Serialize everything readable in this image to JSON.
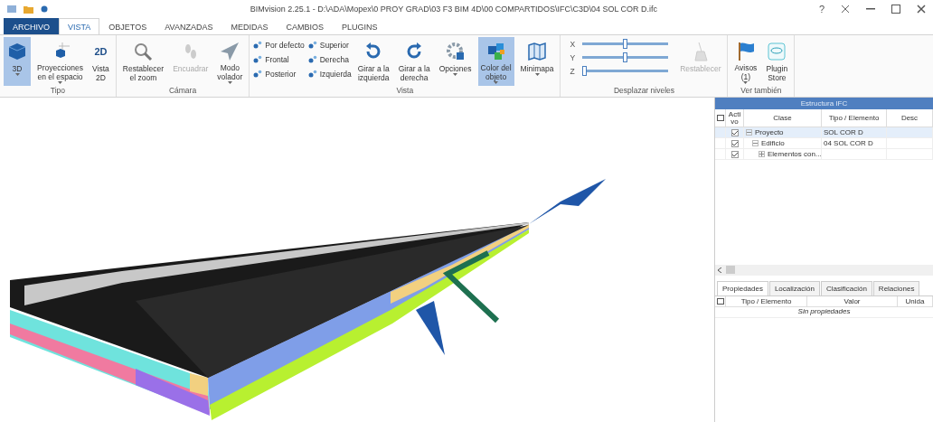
{
  "window": {
    "title": "BIMvision 2.25.1 - D:\\ADA\\Mopex\\0 PROY GRAD\\03 F3 BIM 4D\\00 COMPARTIDOS\\IFC\\C3D\\04 SOL COR D.ifc",
    "help": "?"
  },
  "ribbon_tabs": [
    {
      "label": "ARCHIVO",
      "kind": "file",
      "selected": false
    },
    {
      "label": "VISTA",
      "kind": "tab",
      "selected": true
    },
    {
      "label": "OBJETOS",
      "kind": "tab",
      "selected": false
    },
    {
      "label": "AVANZADAS",
      "kind": "tab",
      "selected": false
    },
    {
      "label": "MEDIDAS",
      "kind": "tab",
      "selected": false
    },
    {
      "label": "CAMBIOS",
      "kind": "tab",
      "selected": false
    },
    {
      "label": "PLUGINS",
      "kind": "tab",
      "selected": false
    }
  ],
  "ribbon_groups": [
    {
      "label": "Tipo",
      "items": [
        {
          "kind": "large",
          "lines": [
            "3D"
          ],
          "dropdown": true,
          "selected": true,
          "disabled": false
        },
        {
          "kind": "large",
          "lines": [
            "Proyecciones",
            "en el espacio"
          ],
          "dropdown": true,
          "selected": false,
          "disabled": false
        },
        {
          "kind": "large",
          "lines": [
            "Vista",
            "2D"
          ],
          "icon_text": "2D",
          "dropdown": false,
          "selected": false,
          "disabled": false
        }
      ]
    },
    {
      "label": "Cámara",
      "items": [
        {
          "kind": "large",
          "lines": [
            "Restablecer",
            "el zoom"
          ],
          "dropdown": false,
          "selected": false,
          "disabled": false
        },
        {
          "kind": "large",
          "lines": [
            "Encuadrar"
          ],
          "dropdown": false,
          "selected": false,
          "disabled": true
        },
        {
          "kind": "large",
          "lines": [
            "Modo",
            "volador"
          ],
          "dropdown": true,
          "selected": false,
          "disabled": false
        }
      ]
    },
    {
      "label": "Vista",
      "items": [
        {
          "kind": "stack",
          "buttons": [
            "Por defecto",
            "Frontal",
            "Posterior"
          ]
        },
        {
          "kind": "stack",
          "buttons": [
            "Superior",
            "Derecha",
            "Izquierda"
          ]
        },
        {
          "kind": "large",
          "lines": [
            "Girar a la",
            "izquierda"
          ],
          "dropdown": false,
          "selected": false,
          "disabled": false
        },
        {
          "kind": "large",
          "lines": [
            "Girar a la",
            "derecha"
          ],
          "dropdown": false,
          "selected": false,
          "disabled": false
        },
        {
          "kind": "large",
          "lines": [
            "Opciones"
          ],
          "dropdown": true,
          "selected": false,
          "disabled": false
        },
        {
          "kind": "large",
          "lines": [
            "Color del",
            "objeto"
          ],
          "dropdown": true,
          "selected": true,
          "disabled": false
        },
        {
          "kind": "large",
          "lines": [
            "Minimapa"
          ],
          "dropdown": true,
          "selected": false,
          "disabled": false
        }
      ]
    },
    {
      "label": "Desplazar niveles",
      "items": [
        {
          "kind": "sliders",
          "sliders": [
            {
              "axis": "X",
              "level": 0.5
            },
            {
              "axis": "Y",
              "level": 0.5
            },
            {
              "axis": "Z",
              "level": 0
            }
          ]
        },
        {
          "kind": "large",
          "lines": [
            "Restablecer"
          ],
          "dropdown": false,
          "selected": false,
          "disabled": true
        }
      ]
    },
    {
      "label": "Ver también",
      "items": [
        {
          "kind": "large",
          "lines": [
            "Avisos",
            "(1)"
          ],
          "dropdown": true,
          "selected": false,
          "disabled": false
        },
        {
          "kind": "large",
          "lines": [
            "Plugin",
            "Store"
          ],
          "dropdown": false,
          "selected": false,
          "disabled": false
        }
      ]
    }
  ],
  "structure_panel": {
    "title": "Estructura IFC",
    "columns": [
      "Acti vo",
      "Clase",
      "Tipo / Elemento",
      "Desc"
    ],
    "rows": [
      {
        "clase": "Proyecto",
        "tipo": "SOL COR D",
        "checked": true,
        "expanded": true,
        "selected": true,
        "children": [
          {
            "clase": "Edificio",
            "tipo": "04 SOL COR D",
            "checked": true,
            "expanded": true,
            "selected": false,
            "children": [
              {
                "clase": "Elementos con...",
                "checked": true,
                "expanded": false,
                "selected": false
              }
            ]
          }
        ]
      }
    ]
  },
  "properties_panel": {
    "tabs": [
      {
        "label": "Propiedades",
        "selected": true
      },
      {
        "label": "Localización",
        "selected": false
      },
      {
        "label": "Clasificación",
        "selected": false
      },
      {
        "label": "Relaciones",
        "selected": false
      }
    ],
    "columns": [
      "Tipo / Elemento",
      "Valor",
      "Unida"
    ],
    "empty_message": "Sin propiedades"
  }
}
